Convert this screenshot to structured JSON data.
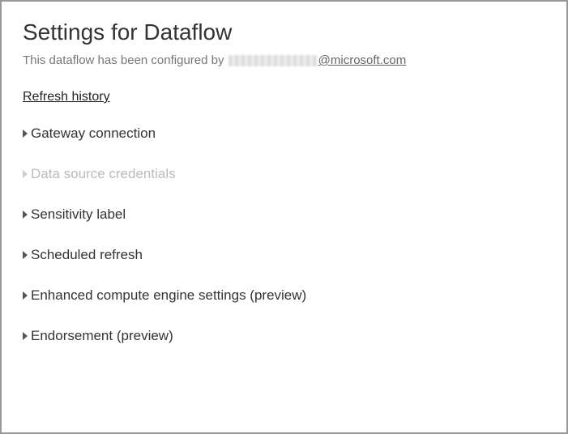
{
  "header": {
    "title": "Settings for Dataflow",
    "subtitle_prefix": "This dataflow has been configured by ",
    "email_domain": "@microsoft.com"
  },
  "links": {
    "refresh_history": "Refresh history"
  },
  "sections": [
    {
      "label": "Gateway connection",
      "enabled": true
    },
    {
      "label": "Data source credentials",
      "enabled": false
    },
    {
      "label": "Sensitivity label",
      "enabled": true
    },
    {
      "label": "Scheduled refresh",
      "enabled": true
    },
    {
      "label": "Enhanced compute engine settings (preview)",
      "enabled": true
    },
    {
      "label": "Endorsement (preview)",
      "enabled": true
    }
  ]
}
